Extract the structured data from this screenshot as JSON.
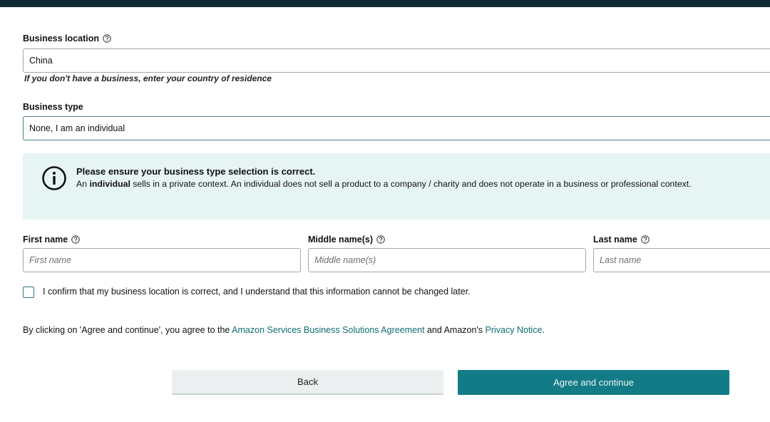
{
  "business_location": {
    "label": "Business location",
    "value": "China",
    "hint": "If you don't have a business, enter your country of residence"
  },
  "business_type": {
    "label": "Business type",
    "value": "None, I am an individual"
  },
  "info_box": {
    "icon": "info-icon",
    "title": "Please ensure your business type selection is correct.",
    "text_prefix": "An ",
    "text_bold": "individual",
    "text_rest": " sells in a private context. An individual does not sell a product to a company / charity and does not operate in a business or professional context."
  },
  "names": {
    "first": {
      "label": "First name",
      "placeholder": "First name"
    },
    "middle": {
      "label": "Middle name(s)",
      "placeholder": "Middle name(s)"
    },
    "last": {
      "label": "Last name",
      "placeholder": "Last name"
    }
  },
  "confirm": {
    "label": "I confirm that my business location is correct, and I understand that this information cannot be changed later.",
    "checked": false
  },
  "agreement": {
    "prefix": "By clicking on 'Agree and continue', you agree to the ",
    "link1": "Amazon Services Business Solutions Agreement",
    "middle": " and Amazon's ",
    "link2": "Privacy Notice",
    "suffix": "."
  },
  "buttons": {
    "back": "Back",
    "agree": "Agree and continue"
  },
  "colors": {
    "accent": "#137b85",
    "info_bg": "#e6f4f3",
    "link": "#0e6c74",
    "top_bar": "#0f2a33"
  }
}
